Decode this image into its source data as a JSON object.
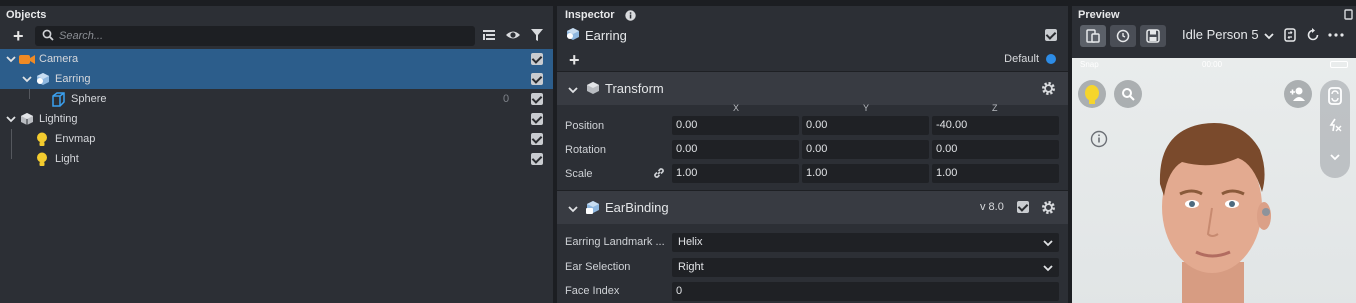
{
  "objects": {
    "title": "Objects",
    "search_placeholder": "Search...",
    "tree": [
      {
        "label": "Camera",
        "icon": "camera-icon",
        "selected": true,
        "count": ""
      },
      {
        "label": "Earring",
        "icon": "earring-object-icon",
        "selected": true,
        "count": ""
      },
      {
        "label": "Sphere",
        "icon": "mesh-cube-icon",
        "selected": false,
        "count": "0"
      },
      {
        "label": "Lighting",
        "icon": "lighting-group-icon",
        "selected": false,
        "count": ""
      },
      {
        "label": "Envmap",
        "icon": "light-bulb-icon",
        "selected": false,
        "count": ""
      },
      {
        "label": "Light",
        "icon": "light-bulb-icon",
        "selected": false,
        "count": ""
      }
    ]
  },
  "inspector": {
    "title": "Inspector",
    "object_name": "Earring",
    "layer_label": "Default",
    "transform": {
      "title": "Transform",
      "columns": [
        "X",
        "Y",
        "Z"
      ],
      "rows": [
        {
          "label": "Position",
          "values": [
            "0.00",
            "0.00",
            "-40.00"
          ]
        },
        {
          "label": "Rotation",
          "values": [
            "0.00",
            "0.00",
            "0.00"
          ]
        },
        {
          "label": "Scale",
          "values": [
            "1.00",
            "1.00",
            "1.00"
          ]
        }
      ]
    },
    "ear_binding": {
      "title": "EarBinding",
      "version": "v 8.0",
      "fields": [
        {
          "label": "Earring Landmark ...",
          "value": "Helix"
        },
        {
          "label": "Ear Selection",
          "value": "Right"
        },
        {
          "label": "Face Index",
          "value": "0"
        }
      ]
    }
  },
  "preview": {
    "title": "Preview",
    "preset": "Idle Person 5",
    "status_carrier": "Snap",
    "status_time": "00:00"
  },
  "colors": {
    "selection": "#2c5d8b",
    "panel": "#2c2f35",
    "accent_blue": "#2d8ce6"
  }
}
